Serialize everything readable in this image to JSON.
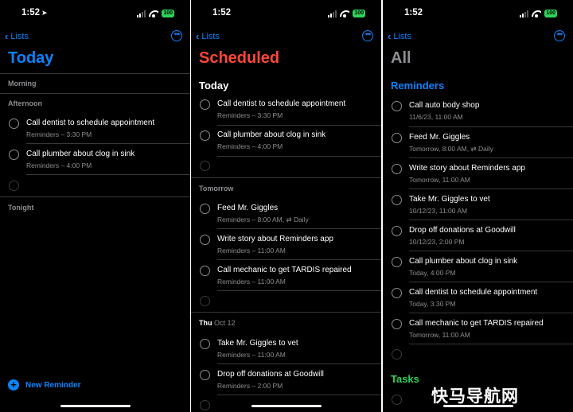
{
  "status_time": "1:52",
  "battery": "100",
  "nav": {
    "back_label": "Lists"
  },
  "today": {
    "title": "Today",
    "morning": "Morning",
    "afternoon": "Afternoon",
    "tonight": "Tonight",
    "items": [
      {
        "title": "Call dentist to schedule appointment",
        "subtitle": "Reminders – 3:30 PM"
      },
      {
        "title": "Call plumber about clog in sink",
        "subtitle": "Reminders – 4:00 PM"
      }
    ],
    "new_reminder": "New Reminder"
  },
  "scheduled": {
    "title": "Scheduled",
    "today_label": "Today",
    "today_items": [
      {
        "title": "Call dentist to schedule appointment",
        "subtitle": "Reminders – 3:30 PM"
      },
      {
        "title": "Call plumber about clog in sink",
        "subtitle": "Reminders – 4:00 PM"
      }
    ],
    "tomorrow_label": "Tomorrow",
    "tomorrow_items": [
      {
        "title": "Feed Mr. Giggles",
        "subtitle": "Reminders – 8:00 AM, ⇄ Daily"
      },
      {
        "title": "Write story about Reminders app",
        "subtitle": "Reminders – 11:00 AM"
      },
      {
        "title": "Call mechanic to get TARDIS repaired",
        "subtitle": "Reminders – 11:00 AM"
      }
    ],
    "thu_day": "Thu",
    "thu_date": "Oct 12",
    "thu_items": [
      {
        "title": "Take Mr. Giggles to vet",
        "subtitle": "Reminders – 11:00 AM"
      },
      {
        "title": "Drop off donations at Goodwill",
        "subtitle": "Reminders – 2:00 PM"
      }
    ]
  },
  "all": {
    "title": "All",
    "reminders_label": "Reminders",
    "items": [
      {
        "title": "Call auto body shop",
        "subtitle": "11/6/23, 11:00 AM"
      },
      {
        "title": "Feed Mr. Giggles",
        "subtitle": "Tomorrow, 8:00 AM, ⇄ Daily"
      },
      {
        "title": "Write story about Reminders app",
        "subtitle": "Tomorrow, 11:00 AM"
      },
      {
        "title": "Take Mr. Giggles to vet",
        "subtitle": "10/12/23, 11:00 AM"
      },
      {
        "title": "Drop off donations at Goodwill",
        "subtitle": "10/12/23, 2:00 PM"
      },
      {
        "title": "Call plumber about clog in sink",
        "subtitle": "Today, 4:00 PM"
      },
      {
        "title": "Call dentist to schedule appointment",
        "subtitle": "Today, 3:30 PM"
      },
      {
        "title": "Call mechanic to get TARDIS repaired",
        "subtitle": "Tomorrow, 11:00 AM"
      }
    ],
    "tasks_label": "Tasks"
  },
  "watermark": "快马导航网",
  "colors": {
    "blue": "#0a84ff",
    "red": "#ff453a",
    "gray": "#8e8e93",
    "green": "#30d158"
  }
}
